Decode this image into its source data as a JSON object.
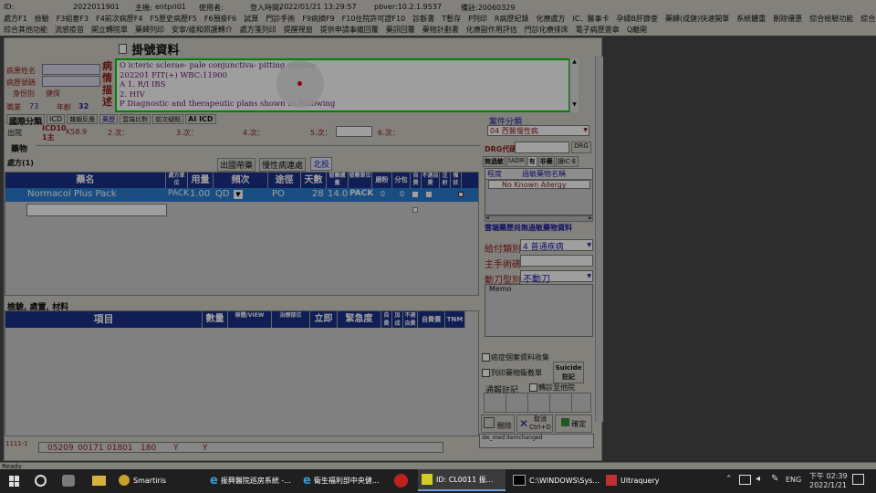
{
  "titlebar": {
    "id_label": "ID:",
    "id_value": "2022011901",
    "host_label": "主機:",
    "host_value": "entpri01",
    "user_label": "使用者:",
    "login_label": "登入時間:",
    "login_time": "2022/01/21 13:29:57",
    "pbver": "pbver:10.2.1.9537",
    "note": "備註:20060329"
  },
  "menu_row1": [
    "處方F1",
    "檢驗",
    "F3組套F3",
    "F4前次病歷F4",
    "F5歷史病歷F5",
    "F6預掛F6",
    "試算",
    "門診手術",
    "F9病摘F9",
    "F10住院許可證F10",
    "診斷書",
    "T暫存",
    "P列印",
    "R病歷紀錄",
    "化療處方",
    "IC．醫事卡",
    "孕婦B肝篩查",
    "藥歸(成健)快速開單",
    "系統體重",
    "刪除優惠",
    "綜合檢驗功能",
    "綜合藥品功能"
  ],
  "menu_row2": [
    "綜合其他功能",
    "流感疫苗",
    "開立轉院單",
    "藥歸列印",
    "安寧/緩和照護轉介",
    "處方箋列印",
    "提醒視窗",
    "提供申請事繼回覆",
    "藥訊回覆",
    "藥物計劃書",
    "化療副作用評估",
    "門診化療排床",
    "電子病歷簽章",
    "Q離開"
  ],
  "registration": {
    "title": "掛號資料",
    "name_label": "病患姓名",
    "chart_label": "病歷號碼",
    "identity_label": "身份別",
    "identity_value": "健保",
    "occupation_label": "職業",
    "occupation_value": "73",
    "age_label": "年齡",
    "age_value": "32"
  },
  "history": {
    "side_label": "病情描述",
    "lines": [
      "O icteric sclerae-  pale conjunctiva-  pitting edema-",
      "202201 FIT(+) WBC:11900",
      "A 1. R/I IBS",
      "    2. HIV",
      "P Diagnostic and therapeutic plans shown as following"
    ]
  },
  "diagnosis": {
    "tabs": [
      "國際分類",
      "ICD",
      "雜報反應",
      "藥歷",
      "雲端比對",
      "前次疑點",
      "AI ICD"
    ],
    "discharge_label": "出院",
    "icd_label": "ICD10",
    "main_label": "1主",
    "code": "K58.9",
    "slots": [
      "2.次：",
      "3.次：",
      "4.次：",
      "5.次：",
      "6.次："
    ]
  },
  "drug_section": {
    "title": "藥物",
    "rx_label": "處方(1)",
    "buttons": [
      "出國帶藥",
      "慢性病連處",
      "北投"
    ],
    "columns": [
      "藥名",
      "處方單位",
      "用量",
      "頻次",
      "途徑",
      "天數",
      "發藥總量",
      "發藥單位",
      "磨粉",
      "分包",
      "自費",
      "不適自費",
      "注射",
      "備註"
    ],
    "row": {
      "name": "Normacol Plus Pack",
      "unit": "PACK",
      "dose": "1.00",
      "freq": "QD",
      "route": "PO",
      "days": "28",
      "total": "14.0",
      "dispense_unit": "PACK",
      "grind": "0",
      "split": "0"
    }
  },
  "exam_section": {
    "title": "檢驗, 處置, 材料",
    "columns": [
      "項目",
      "數量",
      "檢體/VIEW",
      "治療部位",
      "立即",
      "緊急度",
      "自費",
      "加成",
      "不適自費",
      "自費價",
      "TNM"
    ]
  },
  "right_panel": {
    "case_label": "案件分類",
    "case_value": "04   西醫慢性病",
    "drg_label": "DRG代碼",
    "drg_button": "DRG",
    "tags": [
      "無過敏",
      "tADR",
      "有",
      "非藥",
      "讀IC卡"
    ],
    "allergy_cols": [
      "程度",
      "過敏藥物名稱"
    ],
    "allergy_value": "No Known Allergy",
    "cloud_link": "雲端藥歷尚無過敏藥物資料",
    "payment_label": "給付類別",
    "payment_value": "4     普通疾病",
    "procedure_label": "主手術碼",
    "op_type_label": "動刀型別",
    "op_type_value": "不動刀",
    "memo_label": "Memo",
    "cancer_check": "癌症個案資料收集",
    "print_check": "列印藥物衛教單",
    "suicide_button": "Suicide註記",
    "notify_label": "通報註記",
    "transfer_check": "轉診至他院",
    "delete_button": "刪除",
    "cancel_button": "取消 Ctrl+D",
    "confirm_button": "確定",
    "status_line": "dw_med  itemchanged"
  },
  "bottom_codes": [
    "05209",
    "00171",
    "01801",
    "180",
    "Y",
    "Y"
  ],
  "bottom_left": "1111-1",
  "status_text": "Ready",
  "taskbar": {
    "items": [
      "Smartiris",
      "振興醫院巡房系統 -...",
      "衛生福利部中央健...",
      "ID: CL0011     振...",
      "C:\\WINDOWS\\Sys...",
      "Ultraquery"
    ],
    "lang": "ENG",
    "time": "下午 02:39",
    "date": "2022/1/21"
  },
  "colors": {
    "accent": "#1c2f8a",
    "label": "#8b1a1a",
    "highlight": "#2a7fd4",
    "focus": "#00d000",
    "cursor": "#e00000"
  }
}
